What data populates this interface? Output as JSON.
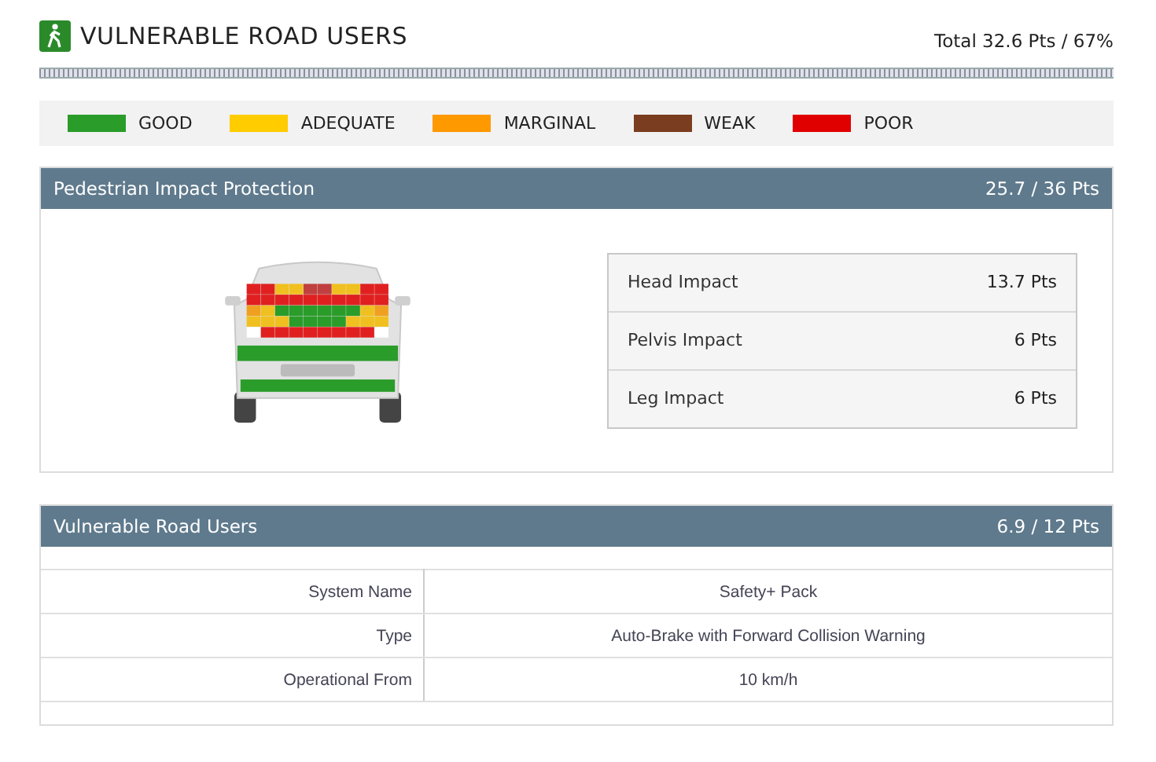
{
  "header": {
    "title": "VULNERABLE ROAD USERS",
    "total": "Total 32.6 Pts / 67%"
  },
  "legend": [
    {
      "label": "GOOD",
      "color": "#2a9c2a"
    },
    {
      "label": "ADEQUATE",
      "color": "#ffcc00"
    },
    {
      "label": "MARGINAL",
      "color": "#ff9900"
    },
    {
      "label": "WEAK",
      "color": "#7a3d1f"
    },
    {
      "label": "POOR",
      "color": "#e00000"
    }
  ],
  "pedestrian": {
    "title": "Pedestrian Impact Protection",
    "score": "25.7 / 36 Pts",
    "impacts": [
      {
        "label": "Head Impact",
        "points": "13.7 Pts"
      },
      {
        "label": "Pelvis Impact",
        "points": "6 Pts"
      },
      {
        "label": "Leg Impact",
        "points": "6 Pts"
      }
    ]
  },
  "vru": {
    "title": "Vulnerable Road Users",
    "score": "6.9 / 12 Pts",
    "rows": [
      {
        "label": "System Name",
        "value": "Safety+ Pack"
      },
      {
        "label": "Type",
        "value": "Auto-Brake with Forward Collision Warning"
      },
      {
        "label": "Operational From",
        "value": "10 km/h"
      }
    ]
  }
}
